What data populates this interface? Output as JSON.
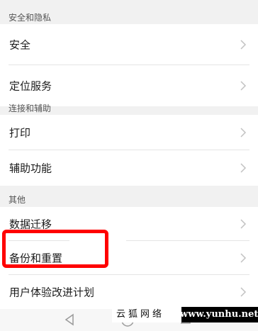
{
  "sections": {
    "privacy": {
      "header": "安全和隐私",
      "items": [
        "安全",
        "定位服务"
      ]
    },
    "assist": {
      "header": "连接和辅助",
      "items": [
        "打印",
        "辅助功能"
      ]
    },
    "other": {
      "header": "其他",
      "items": [
        "数据迁移",
        "备份和重置",
        "用户体验改进计划"
      ]
    }
  },
  "annotation": {
    "color": "#ff0000"
  },
  "watermark": {
    "cn": "云狐网络",
    "url": "www.yunhu.net"
  },
  "navbar": {
    "icons": [
      "back-icon",
      "home-icon",
      "recents-icon"
    ]
  }
}
